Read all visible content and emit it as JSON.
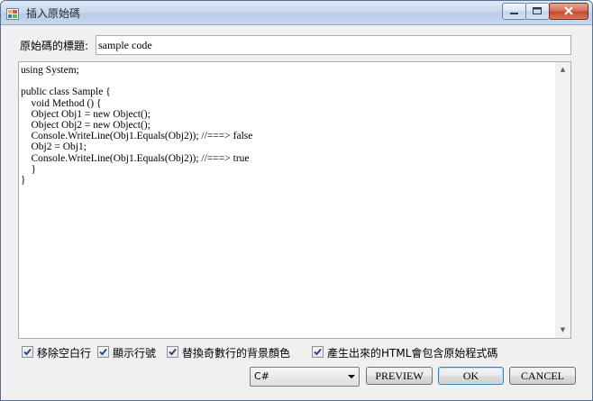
{
  "window": {
    "title": "插入原始碼"
  },
  "form": {
    "title_label": "原始碼的標題:",
    "title_value": "sample code",
    "code": "using System;\n\npublic class Sample {\n    void Method () {\n    Object Obj1 = new Object();\n    Object Obj2 = new Object();\n    Console.WriteLine(Obj1.Equals(Obj2)); //===> false\n    Obj2 = Obj1;\n    Console.WriteLine(Obj1.Equals(Obj2)); //===> true\n    }\n}"
  },
  "options": [
    {
      "label": "移除空白行",
      "checked": true
    },
    {
      "label": "顯示行號",
      "checked": true
    },
    {
      "label": "替換奇數行的背景顏色",
      "checked": true
    },
    {
      "label": "產生出來的HTML會包含原始程式碼",
      "checked": true
    }
  ],
  "language_select": {
    "value": "C#"
  },
  "buttons": {
    "preview": "PREVIEW",
    "ok": "OK",
    "cancel": "CANCEL"
  }
}
